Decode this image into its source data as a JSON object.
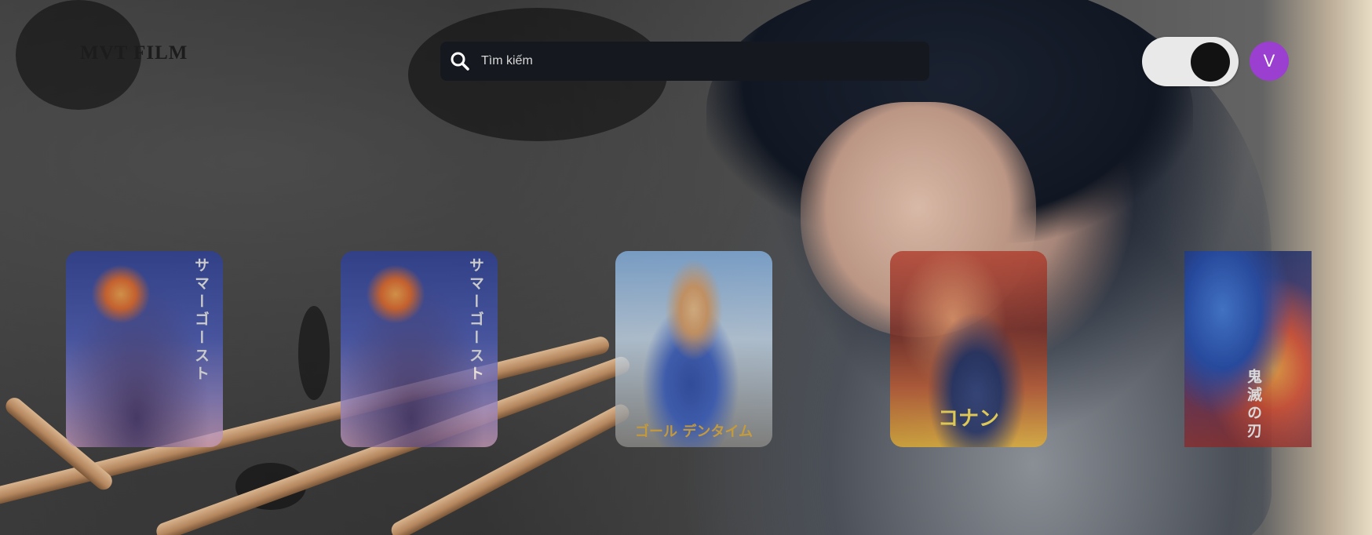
{
  "header": {
    "logo_text": "MVT FILM",
    "search": {
      "placeholder": "Tìm kiếm",
      "value": ""
    },
    "theme_toggle": {
      "state": "dark"
    },
    "avatar": {
      "initial": "V",
      "color": "#9b3fd0"
    }
  },
  "movies": [
    {
      "title": "サマーゴースト"
    },
    {
      "title": "サマーゴースト"
    },
    {
      "title": "ゴール デンタイム"
    },
    {
      "title": "コナン"
    },
    {
      "title": "鬼滅の刃"
    }
  ],
  "icons": {
    "search": "search-icon"
  },
  "colors": {
    "search_bg": "#15191f",
    "toggle_bg": "#e9e9e9",
    "toggle_knob": "#121212",
    "avatar_bg": "#9b3fd0"
  }
}
